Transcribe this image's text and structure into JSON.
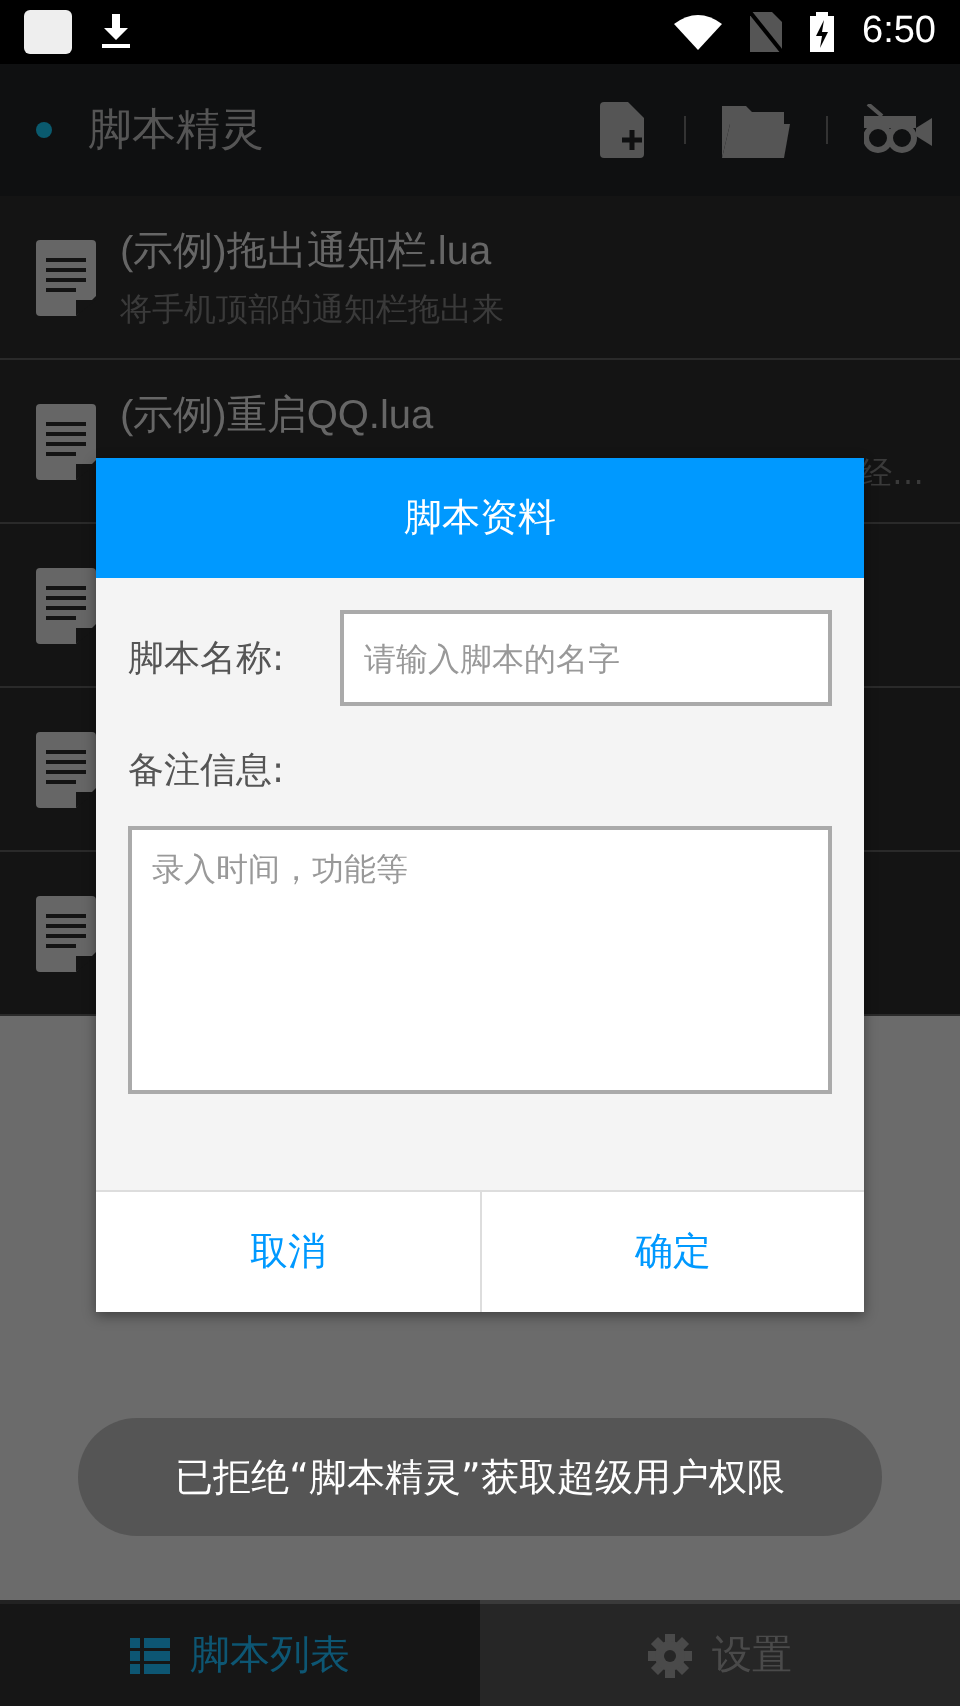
{
  "status_bar": {
    "time": "6:50"
  },
  "app_bar": {
    "title": "脚本精灵"
  },
  "scripts": [
    {
      "kind": "script",
      "title": "(示例)拖出通知栏.lua",
      "subtitle": "将手机顶部的通知栏拖出来",
      "subtitle_clipped": false
    },
    {
      "kind": "script",
      "title": "(示例)重启QQ.lua",
      "subtitle": "经…",
      "subtitle_clipped": true
    },
    {
      "kind": "covered"
    },
    {
      "kind": "covered"
    },
    {
      "kind": "covered"
    }
  ],
  "dialog": {
    "title": "脚本资料",
    "name_label": "脚本名称:",
    "name_placeholder": "请输入脚本的名字",
    "note_label": "备注信息:",
    "note_placeholder": "录入时间，功能等",
    "buttons": [
      "取消",
      "确定"
    ]
  },
  "toast": "已拒绝“脚本精灵”获取超级用户权限",
  "tabs": [
    {
      "label": "脚本列表",
      "selected": true,
      "kind": "list"
    },
    {
      "label": "设置",
      "selected": false,
      "kind": "settings"
    }
  ]
}
